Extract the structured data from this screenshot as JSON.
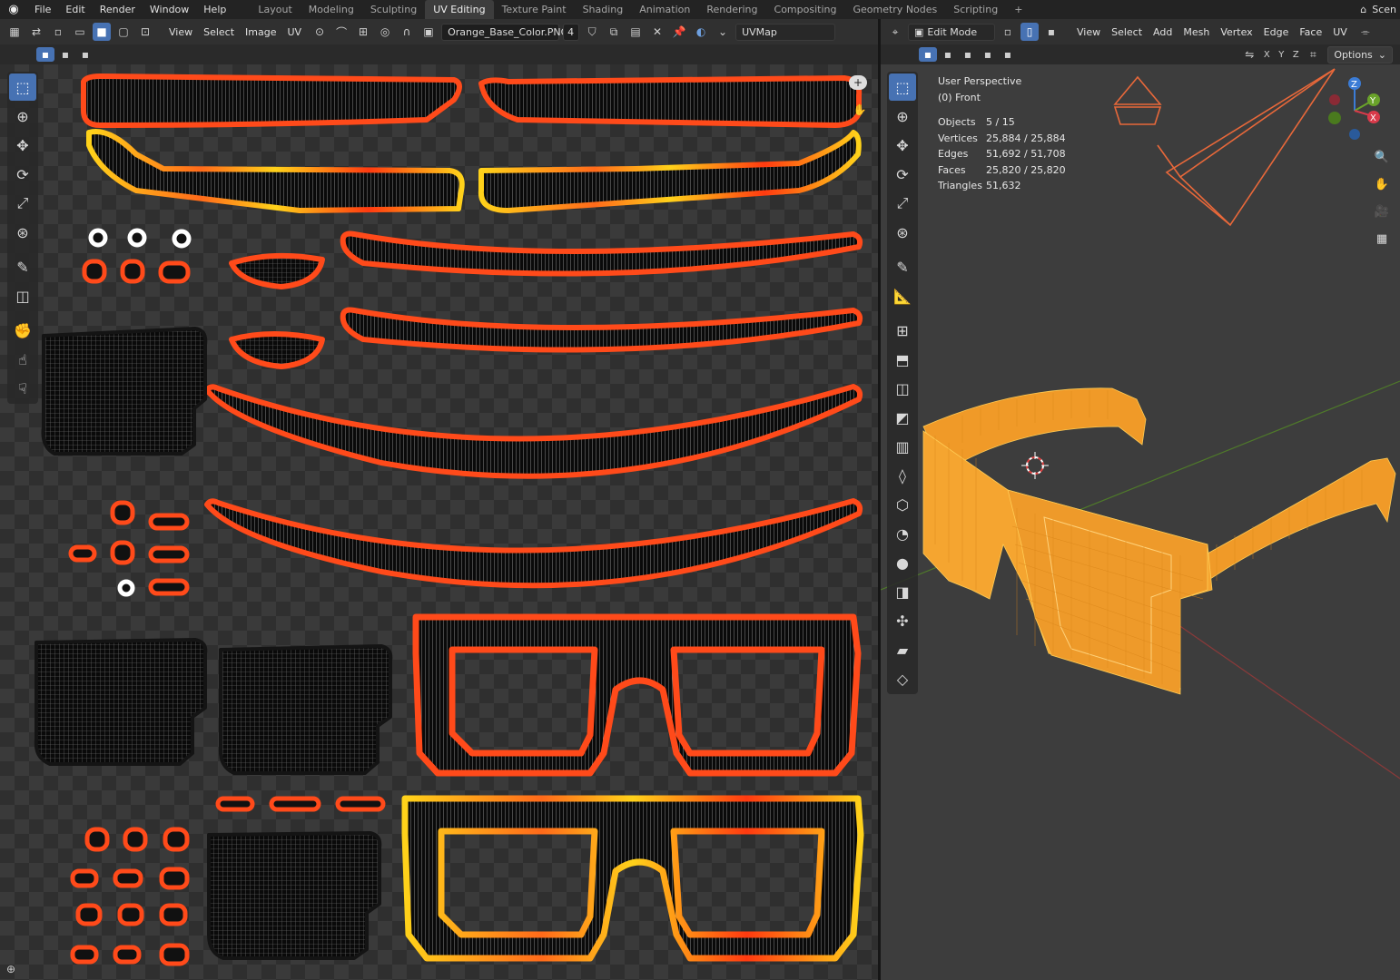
{
  "top_menu": [
    "File",
    "Edit",
    "Render",
    "Window",
    "Help"
  ],
  "workspaces": [
    {
      "label": "Layout",
      "active": false
    },
    {
      "label": "Modeling",
      "active": false
    },
    {
      "label": "Sculpting",
      "active": false
    },
    {
      "label": "UV Editing",
      "active": true
    },
    {
      "label": "Texture Paint",
      "active": false
    },
    {
      "label": "Shading",
      "active": false
    },
    {
      "label": "Animation",
      "active": false
    },
    {
      "label": "Rendering",
      "active": false
    },
    {
      "label": "Compositing",
      "active": false
    },
    {
      "label": "Geometry Nodes",
      "active": false
    },
    {
      "label": "Scripting",
      "active": false
    }
  ],
  "add_workspace": "+",
  "scene_label": "Scen",
  "uv_editor": {
    "menus": [
      "View",
      "Select",
      "Image",
      "UV"
    ],
    "image_name": "Orange_Base_Color.PNG",
    "image_users": "4",
    "uv_map": "UVMap"
  },
  "viewport": {
    "mode": "Edit Mode",
    "menus": [
      "View",
      "Select",
      "Add",
      "Mesh",
      "Vertex",
      "Edge",
      "Face",
      "UV"
    ],
    "axes": [
      "X",
      "Y",
      "Z"
    ],
    "options_label": "Options",
    "perspective": "User Perspective",
    "view_name": "(0) Front",
    "stats": [
      {
        "label": "Objects",
        "value": "5 / 15"
      },
      {
        "label": "Vertices",
        "value": "25,884 / 25,884"
      },
      {
        "label": "Edges",
        "value": "51,692 / 51,708"
      },
      {
        "label": "Faces",
        "value": "25,820 / 25,820"
      },
      {
        "label": "Triangles",
        "value": "51,632"
      }
    ],
    "gizmo_labels": [
      "Z",
      "Y",
      "X"
    ]
  },
  "colors": {
    "accent": "#4772b3",
    "uv_outline": "#ff4a1a",
    "uv_yellow": "#ffd21a",
    "mesh_orange": "#f0a030",
    "camera_orange": "#e8683a"
  },
  "icons": {
    "uv_tools": [
      "select-box-icon",
      "cursor-icon",
      "move-icon",
      "rotate-icon",
      "scale-icon",
      "transform-icon",
      "annotate-icon",
      "rip-region-icon",
      "grab-icon",
      "relax-icon",
      "pinch-icon"
    ],
    "viewport_tools": [
      "select-box-icon",
      "cursor-icon",
      "move-icon",
      "rotate-icon",
      "scale-icon",
      "transform-icon",
      "annotate-icon",
      "measure-icon",
      "add-cube-icon",
      "extrude-icon",
      "inset-icon",
      "bevel-icon",
      "loop-cut-icon",
      "knife-icon",
      "poly-build-icon",
      "spin-icon",
      "smooth-icon",
      "edge-slide-icon",
      "shrink-fatten-icon",
      "shear-icon",
      "rip-icon"
    ]
  }
}
